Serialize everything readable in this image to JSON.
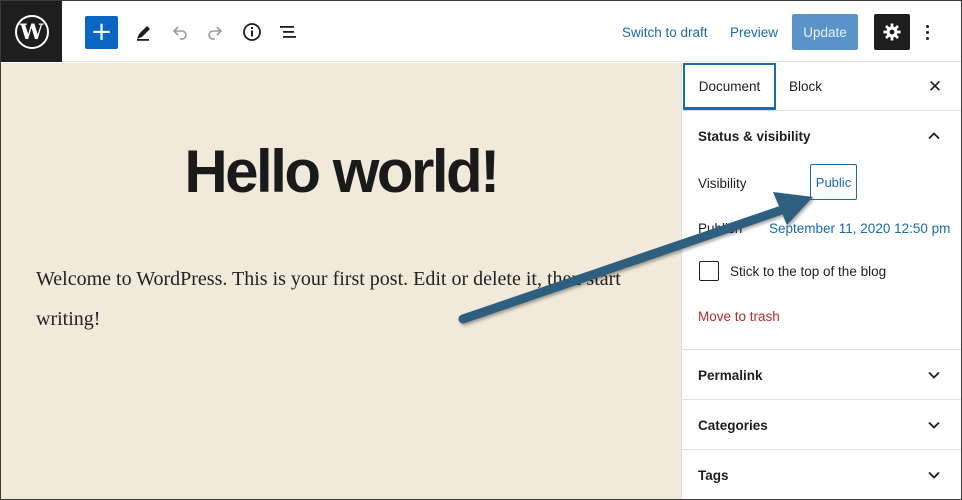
{
  "toolbar": {
    "logo_glyph": "W",
    "add_glyph": "+",
    "switch_to_draft": "Switch to draft",
    "preview": "Preview",
    "update": "Update",
    "icons": [
      "wordpress-logo",
      "plus-icon",
      "pencil-icon",
      "undo-icon",
      "redo-icon",
      "info-icon",
      "list-view-icon",
      "gear-icon",
      "more-vertical-icon"
    ]
  },
  "post": {
    "title": "Hello world!",
    "body": "Welcome to WordPress. This is your first post. Edit or delete it, then start writing!"
  },
  "sidebar": {
    "tabs": [
      {
        "label": "Document",
        "active": true
      },
      {
        "label": "Block",
        "active": false
      }
    ],
    "close_glyph": "✕",
    "status": {
      "title": "Status & visibility",
      "visibility_label": "Visibility",
      "visibility_value": "Public",
      "publish_label": "Publish",
      "publish_value": "September 11, 2020 12:50 pm",
      "sticky_label": "Stick to the top of the blog",
      "trash_label": "Move to trash"
    },
    "panels": [
      {
        "title": "Permalink"
      },
      {
        "title": "Categories"
      },
      {
        "title": "Tags"
      }
    ]
  },
  "colors": {
    "accent": "#0a66c2",
    "link": "#1a6ab0",
    "canvas_bg": "#f1e9da",
    "annotation_arrow": "#2f5f7f",
    "danger": "#b32d2e"
  }
}
